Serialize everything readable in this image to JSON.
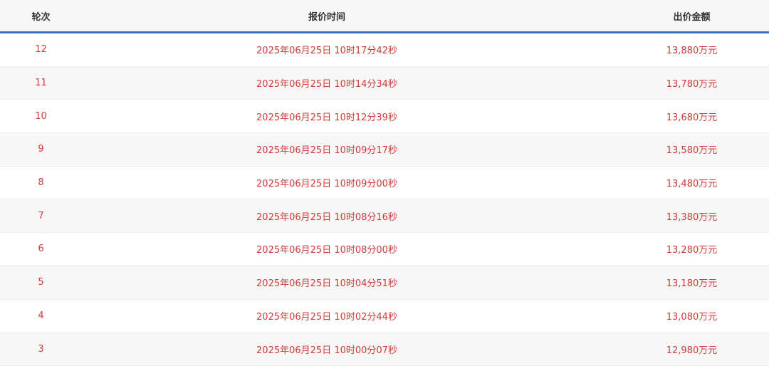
{
  "headers": {
    "round": "轮次",
    "time": "报价时间",
    "amount": "出价金额"
  },
  "rows": [
    {
      "round": "12",
      "time": "2025年06月25日 10时17分42秒",
      "amount": "13,880万元"
    },
    {
      "round": "11",
      "time": "2025年06月25日 10时14分34秒",
      "amount": "13,780万元"
    },
    {
      "round": "10",
      "time": "2025年06月25日 10时12分39秒",
      "amount": "13,680万元"
    },
    {
      "round": "9",
      "time": "2025年06月25日 10时09分17秒",
      "amount": "13,580万元"
    },
    {
      "round": "8",
      "time": "2025年06月25日 10时09分00秒",
      "amount": "13,480万元"
    },
    {
      "round": "7",
      "time": "2025年06月25日 10时08分16秒",
      "amount": "13,380万元"
    },
    {
      "round": "6",
      "time": "2025年06月25日 10时08分00秒",
      "amount": "13,280万元"
    },
    {
      "round": "5",
      "time": "2025年06月25日 10时04分51秒",
      "amount": "13,180万元"
    },
    {
      "round": "4",
      "time": "2025年06月25日 10时02分44秒",
      "amount": "13,080万元"
    },
    {
      "round": "3",
      "time": "2025年06月25日 10时00分07秒",
      "amount": "12,980万元"
    }
  ],
  "colors": {
    "header_accent": "#3b73b9",
    "value_text": "#d13a3a"
  }
}
